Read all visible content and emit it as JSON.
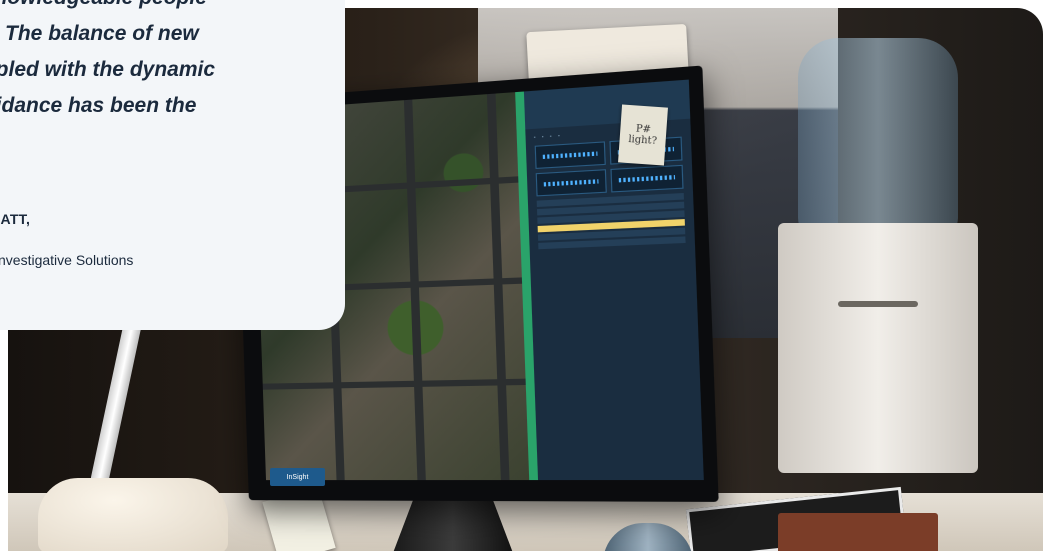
{
  "quote": {
    "lines": "t knowledgeable people\nce. The balance of new\noupled with the dynamic\nguidance has been the\nr.\"",
    "name": "ALGATT,",
    "role": "r of Investigative Solutions"
  },
  "monitor": {
    "logo_text": "InSight",
    "sticky_note": "P# light?"
  },
  "colors": {
    "card_background": "#f3f6f9",
    "quote_text": "#1b2a3d",
    "panel_background": "#1a2d40",
    "accent_green": "#2aa36a",
    "highlight_row": "#f1d36a"
  }
}
